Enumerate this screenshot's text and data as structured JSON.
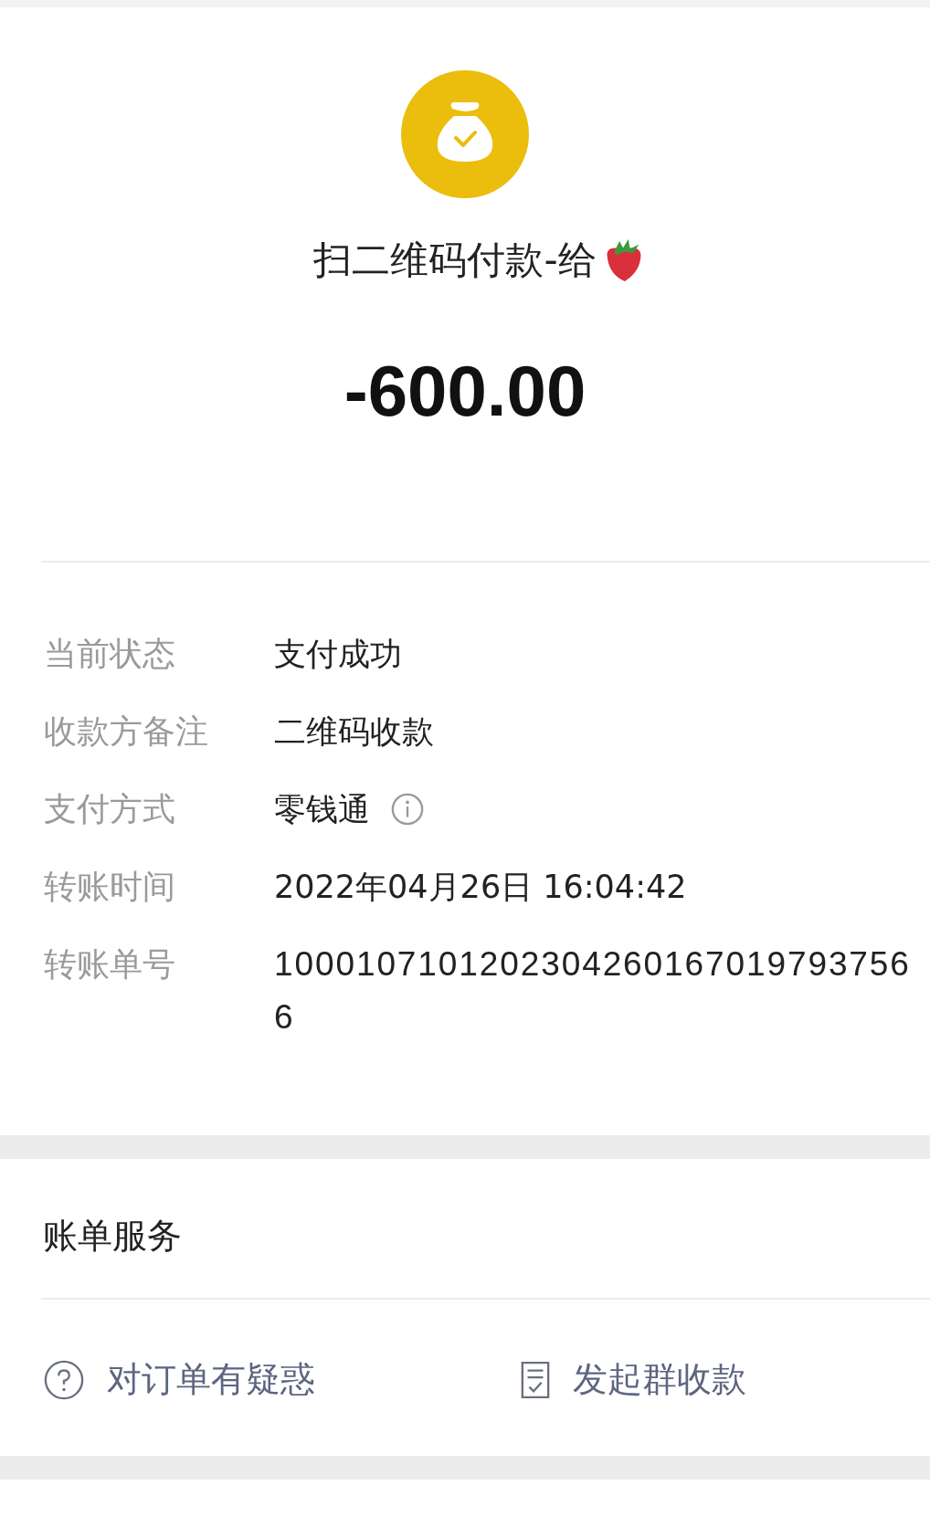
{
  "header": {
    "title": "扫二维码付款-给",
    "amount": "-600.00"
  },
  "details": [
    {
      "label": "当前状态",
      "value": "支付成功",
      "kind": "text"
    },
    {
      "label": "收款方备注",
      "value": "二维码收款",
      "kind": "text"
    },
    {
      "label": "支付方式",
      "value": "零钱通",
      "kind": "info"
    },
    {
      "label": "转账时间",
      "value": "2022年04月26日 16:04:42",
      "kind": "text"
    },
    {
      "label": "转账单号",
      "value": "10001071012023042601670197937566",
      "kind": "number"
    }
  ],
  "services": {
    "title": "账单服务",
    "actions": [
      {
        "label": "对订单有疑惑",
        "kind": "question"
      },
      {
        "label": "发起群收款",
        "kind": "bill"
      }
    ]
  }
}
